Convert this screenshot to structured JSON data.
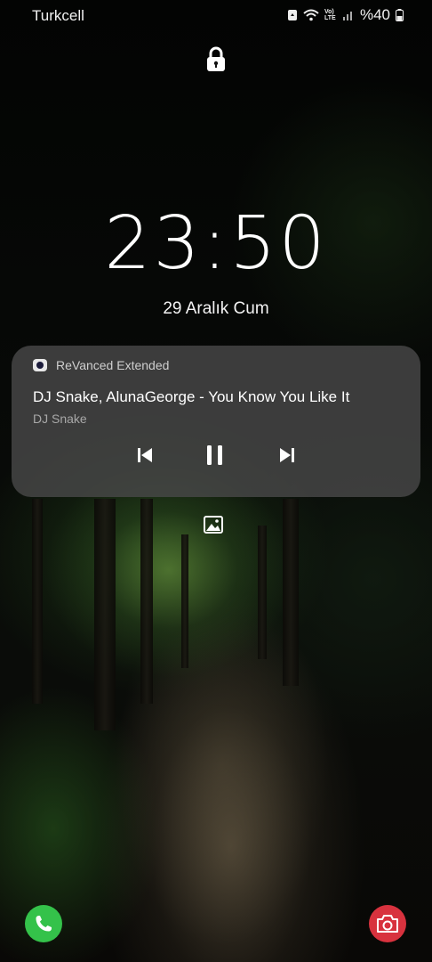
{
  "status_bar": {
    "carrier": "Turkcell",
    "network_label": "Vo) LTE",
    "battery": "%40",
    "icons": [
      "recycle-icon",
      "wifi-icon",
      "volte-icon",
      "signal-icon",
      "battery-icon"
    ]
  },
  "lock": {
    "icon": "lock-icon"
  },
  "clock": {
    "time": "23:50",
    "date": "29 Aralık Cum"
  },
  "media": {
    "app_name": "ReVanced Extended",
    "title": "DJ Snake, AlunaGeorge - You Know You Like It",
    "artist": "DJ Snake",
    "controls": [
      "previous-icon",
      "pause-icon",
      "next-icon"
    ]
  },
  "wallpaper_button": {
    "icon": "gallery-icon"
  },
  "shortcuts": {
    "left": {
      "icon": "phone-icon",
      "color": "#34c24a"
    },
    "right": {
      "icon": "camera-icon",
      "color": "#d8323e"
    }
  }
}
